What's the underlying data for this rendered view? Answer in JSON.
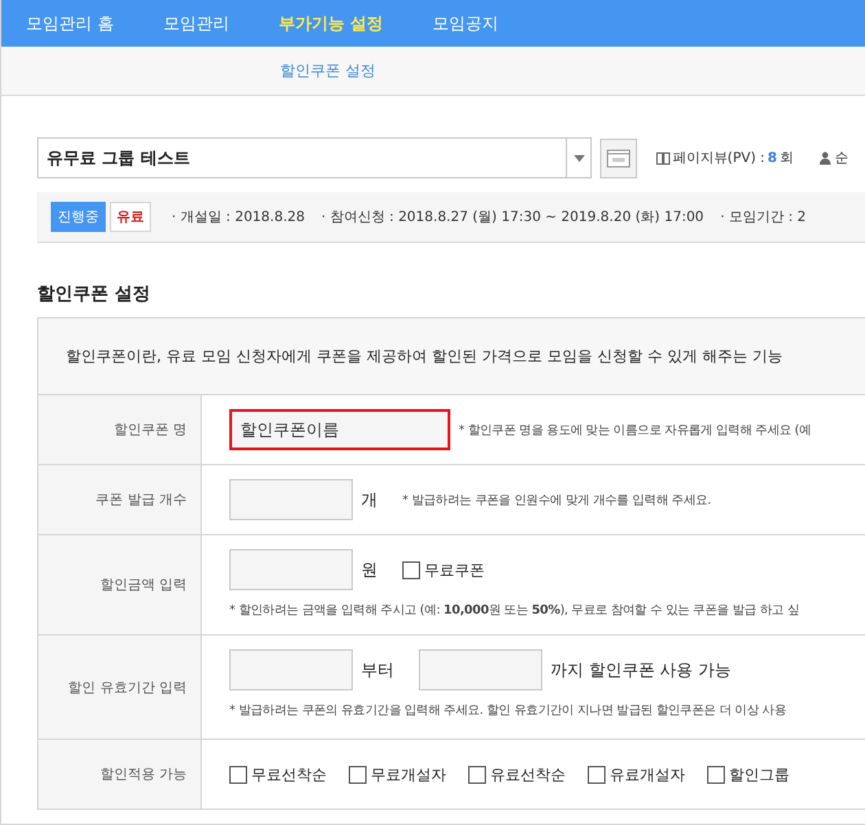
{
  "nav": {
    "items": [
      {
        "label": "모임관리 홈",
        "selected": false
      },
      {
        "label": "모임관리",
        "selected": false
      },
      {
        "label": "부가기능 설정",
        "selected": true
      },
      {
        "label": "모임공지",
        "selected": false
      }
    ]
  },
  "subnav": {
    "items": [
      {
        "label": "할인쿠폰 설정",
        "selected": true
      }
    ]
  },
  "group_select": {
    "value": "유무료 그룹 테스트"
  },
  "stats": [
    {
      "label": "페이지뷰(PV) :",
      "value": "8",
      "unit": "회"
    },
    {
      "label": "순"
    }
  ],
  "status": {
    "badges": [
      {
        "label": "진행중",
        "kind": "state"
      },
      {
        "label": "유료",
        "kind": "paid"
      }
    ],
    "items": [
      "· 개설일 : 2018.8.28",
      "· 참여신청 : 2018.8.27 (월) 17:30 ~ 2019.8.20 (화) 17:00",
      "· 모임기간 : 2"
    ]
  },
  "section": {
    "title": "할인쿠폰 설정",
    "intro": "할인쿠폰이란, 유료 모임 신청자에게 쿠폰을 제공하여 할인된 가격으로 모임을 신청할 수 있게 해주는 기능",
    "rows": [
      {
        "label": "할인쿠폰 명",
        "kind": "name",
        "value": "할인쿠폰이름",
        "highlighted": true,
        "note": "* 할인쿠폰 명을 용도에 맞는 이름으로 자유롭게 입력해 주세요 (예"
      },
      {
        "label": "쿠폰 발급 개수",
        "kind": "count",
        "unit": "개",
        "note": "* 발급하려는 쿠폰을 인원수에 맞게 개수를 입력해 주세요."
      },
      {
        "label": "할인금액 입력",
        "kind": "amount",
        "unit": "원",
        "checkbox": {
          "label": "무료쿠폰",
          "checked": false
        },
        "note": "* 할인하려는 금액을 입력해 주시고 (예: **10,000**원 또는 **50%**), 무료로 참여할 수 있는 쿠폰을 발급 하고 싶"
      },
      {
        "label": "할인 유효기간 입력",
        "kind": "period",
        "from": "부터",
        "to": "까지 할인쿠폰 사용 가능",
        "note": "* 발급하려는 쿠폰의 유효기간을 입력해 주세요. 할인 유효기간이 지나면 발급된 할인쿠폰은 더 이상 사용"
      },
      {
        "label": "할인적용 가능",
        "kind": "checks",
        "options": [
          {
            "label": "무료선착순",
            "checked": false
          },
          {
            "label": "무료개설자",
            "checked": false
          },
          {
            "label": "유료선착순",
            "checked": false
          },
          {
            "label": "유료개설자",
            "checked": false
          },
          {
            "label": "할인그룹",
            "checked": false
          }
        ]
      }
    ]
  }
}
